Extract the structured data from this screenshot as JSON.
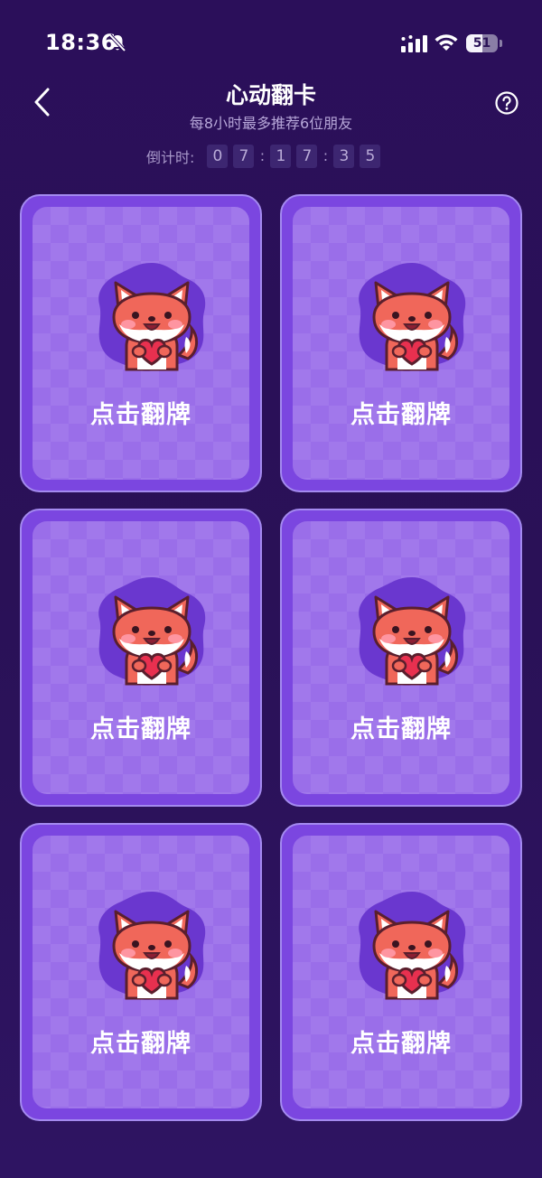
{
  "status_bar": {
    "time": "18:36",
    "battery": "51",
    "battery_level": 0.51
  },
  "header": {
    "title": "心动翻卡",
    "subtitle": "每8小时最多推荐6位朋友"
  },
  "countdown": {
    "label": "倒计时:",
    "digits": [
      "0",
      "7",
      "1",
      "7",
      "3",
      "5"
    ],
    "separator": ":"
  },
  "cards": [
    {
      "label": "点击翻牌"
    },
    {
      "label": "点击翻牌"
    },
    {
      "label": "点击翻牌"
    },
    {
      "label": "点击翻牌"
    },
    {
      "label": "点击翻牌"
    },
    {
      "label": "点击翻牌"
    }
  ],
  "icons": {
    "back": "chevron-left-icon",
    "help": "question-circle-icon",
    "bell": "bell-slash-icon",
    "mascot": "fox-heart-mascot"
  },
  "colors": {
    "background": "#2a1257",
    "card_frame": "#7b46e0",
    "card_face": "#9a6ee9",
    "fox": "#f0675a"
  }
}
